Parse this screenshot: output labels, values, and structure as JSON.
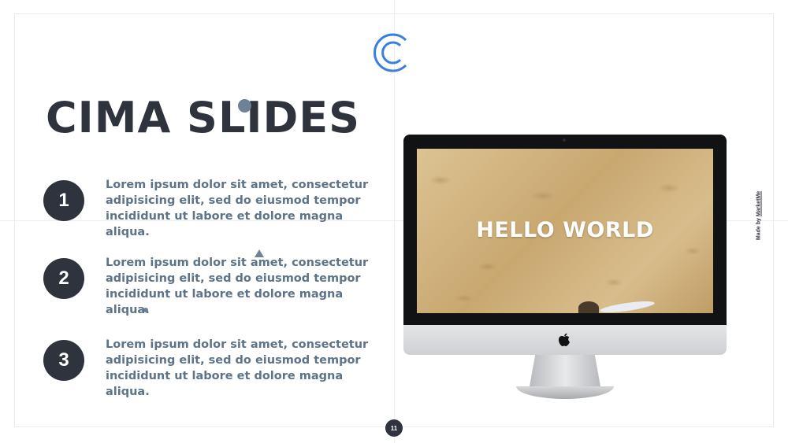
{
  "slide": {
    "title": "CIMA SLIDES",
    "page_number": "11",
    "logo_icon": "c-logo-icon"
  },
  "items": [
    {
      "number": "1",
      "text": "Lorem ipsum dolor sit amet, consectetur adipisicing elit, sed do eiusmod tempor incididunt ut labore et dolore magna aliqua."
    },
    {
      "number": "2",
      "text": "Lorem ipsum dolor sit amet, consectetur adipisicing elit, sed do eiusmod tempor incididunt ut labore et dolore magna aliqua."
    },
    {
      "number": "3",
      "text": "Lorem ipsum dolor sit amet, consectetur adipisicing elit, sed do eiusmod tempor incididunt ut labore et dolore magna aliqua."
    }
  ],
  "monitor": {
    "screen_text": "HELLO WORLD",
    "brand_icon": "apple-icon"
  },
  "credit": {
    "prefix": "Made by",
    "brand": "MarketMe"
  },
  "colors": {
    "accent": "#3a7fe0",
    "dark": "#2f333d",
    "text": "#5d7388",
    "decor": "#6d8298"
  }
}
